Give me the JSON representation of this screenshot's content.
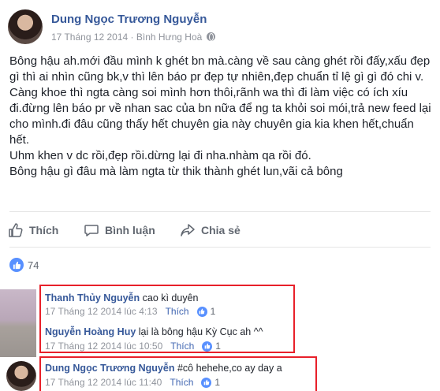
{
  "post": {
    "author": "Dung Ngọc Trương Nguyễn",
    "date": "17 Tháng 12 2014",
    "separator": " · ",
    "location": "Bình Hưng Hoà",
    "privacy_icon": "globe-icon",
    "paragraphs": [
      "Bông hậu ah.mới đầu mình k ghét bn mà.càng về sau càng ghét rồi đấy,xấu đẹp gì thì ai nhìn cũng bk,v thì lên báo pr đẹp tự nhiên,đẹp chuẩn tỉ lệ gì gì đó chi v.",
      "Càng khoe thì ngta càng soi mình hơn thôi,rãnh wa thì đi làm việc có ích xíu đi.đừng lên báo pr về nhan sac của bn nữa để ng ta khỏi soi mói,trả new feed lại cho mình.đi đâu cũng thấy hết chuyên gia này chuyên gia kia khen hết,chuẩn hết.",
      "Uhm khen v dc rồi,đẹp rồi.dừng lại đi nha.nhàm qa rồi đó.",
      "Bông hậu gì đâu mà làm ngta từ thik thành ghét lun,vãi cả bông"
    ]
  },
  "actions": {
    "like": "Thích",
    "comment": "Bình luận",
    "share": "Chia sẻ"
  },
  "reactions": {
    "count": "74"
  },
  "comments": [
    {
      "author": "Thanh Thủy Nguyễn",
      "text": " cao kì duyên",
      "time": "17 Tháng 12 2014 lúc 4:13",
      "like_label": "Thích",
      "likes": "1"
    },
    {
      "author": "Nguyễn Hoàng Huy",
      "text": " lại là bông hậu Kỳ Cục ah ^^",
      "time": "17 Tháng 12 2014 lúc 10:50",
      "like_label": "Thích",
      "likes": "1"
    },
    {
      "author": "Dung Ngọc Trương Nguyễn",
      "text": " #cô hehehe,co ay day a",
      "time": "17 Tháng 12 2014 lúc 11:40",
      "like_label": "Thích",
      "likes": "1"
    }
  ],
  "colors": {
    "link": "#365899",
    "highlight": "#e8202a",
    "like_blue": "#5890ff"
  }
}
